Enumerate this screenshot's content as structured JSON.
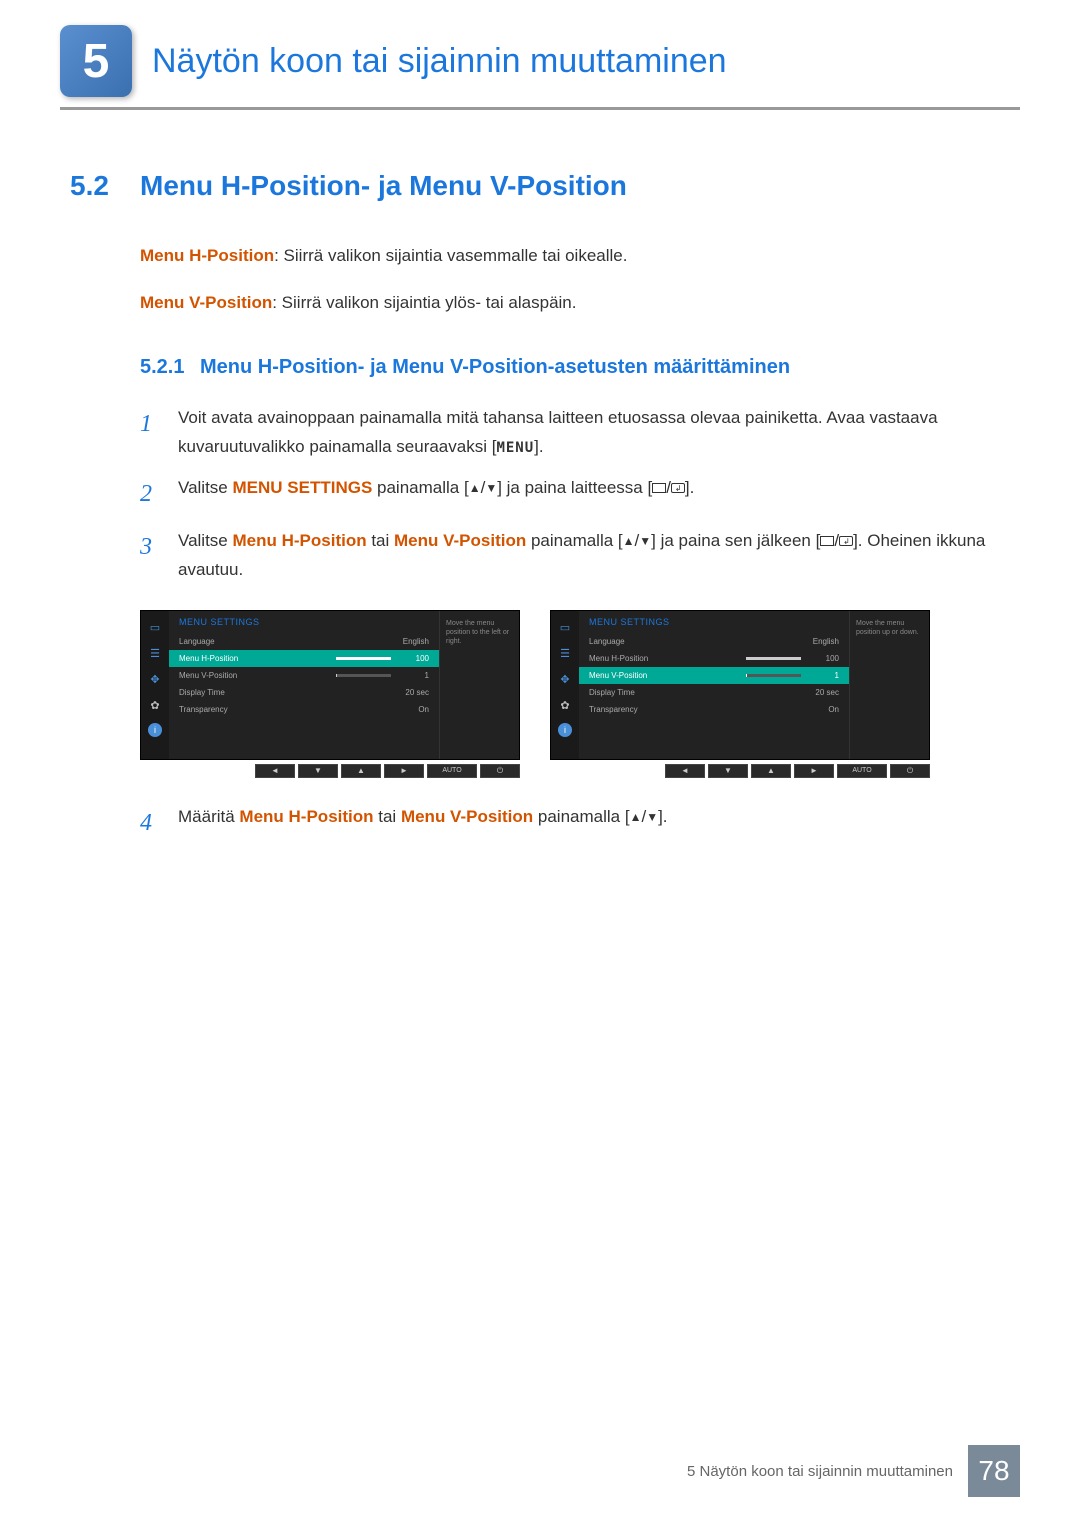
{
  "header": {
    "chapter_num": "5",
    "chapter_title": "Näytön koon tai sijainnin muuttaminen"
  },
  "section": {
    "num": "5.2",
    "title": "Menu H-Position- ja Menu V-Position"
  },
  "intro": {
    "h_label": "Menu H-Position",
    "h_desc": ": Siirrä valikon sijaintia vasemmalle tai oikealle.",
    "v_label": "Menu V-Position",
    "v_desc": ": Siirrä valikon sijaintia ylös- tai alaspäin."
  },
  "subsection": {
    "num": "5.2.1",
    "title": "Menu H-Position- ja Menu V-Position-asetusten määrittäminen"
  },
  "steps": [
    {
      "n": "1",
      "pre": "Voit avata avainoppaan painamalla mitä tahansa laitteen etuosassa olevaa painiketta. Avaa vastaava kuvaruutuvalikko painamalla seuraavaksi [",
      "kbd": "MENU",
      "post": "]."
    },
    {
      "n": "2",
      "pre": "Valitse ",
      "term": "MENU SETTINGS",
      "mid": " painamalla [",
      "post": "] ja paina laitteessa [",
      "post2": "]."
    },
    {
      "n": "3",
      "pre": "Valitse ",
      "term1": "Menu H-Position",
      "mid1": " tai ",
      "term2": "Menu V-Position",
      "mid2": " painamalla [",
      "post": "] ja paina sen jälkeen [",
      "post2": "]. Oheinen ikkuna avautuu."
    },
    {
      "n": "4",
      "pre": "Määritä ",
      "term1": "Menu H-Position",
      "mid1": " tai ",
      "term2": "Menu V-Position",
      "mid2": " painamalla [",
      "post": "]."
    }
  ],
  "osd": {
    "title": "MENU SETTINGS",
    "items": [
      {
        "label": "Language",
        "value": "English",
        "slider": null
      },
      {
        "label": "Menu H-Position",
        "value": "100",
        "slider": 100
      },
      {
        "label": "Menu V-Position",
        "value": "1",
        "slider": 2
      },
      {
        "label": "Display Time",
        "value": "20 sec",
        "slider": null
      },
      {
        "label": "Transparency",
        "value": "On",
        "slider": null
      }
    ],
    "hint_h": "Move the menu position to the left or right.",
    "hint_v": "Move the menu position up or down.",
    "nav": [
      "◄",
      "▼",
      "▲",
      "►"
    ],
    "nav_auto": "AUTO",
    "nav_power": "⏻"
  },
  "footer": {
    "text": "5 Näytön koon tai sijainnin muuttaminen",
    "page": "78"
  }
}
